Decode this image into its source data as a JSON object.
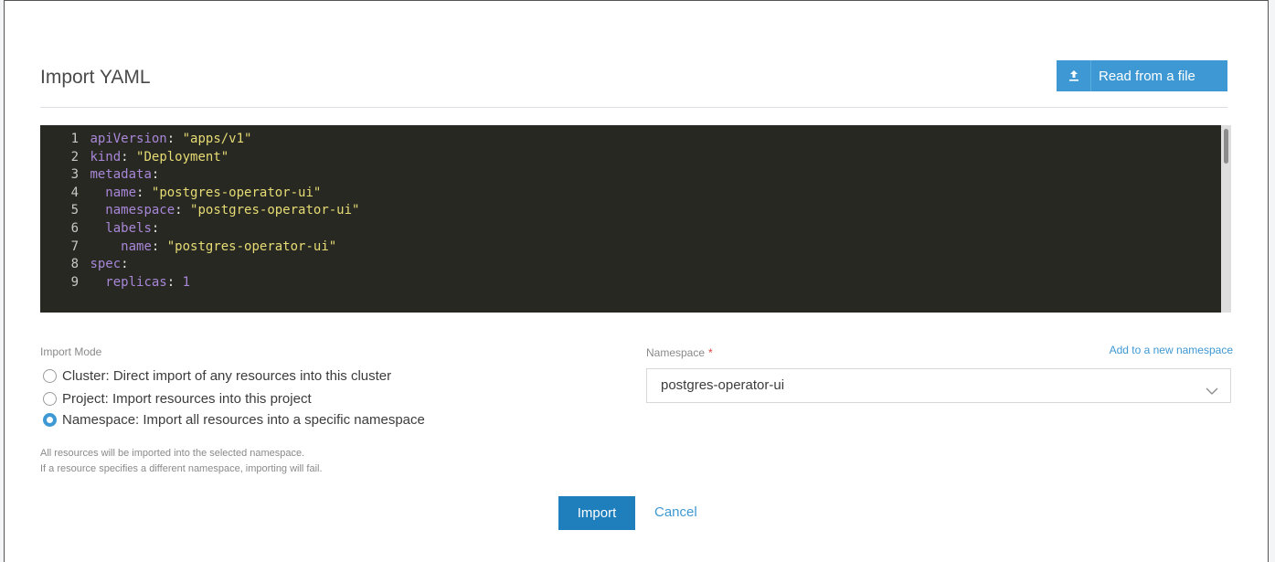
{
  "header": {
    "title": "Import YAML",
    "read_file_label": "Read from a file",
    "read_file_icon": "upload-icon"
  },
  "editor": {
    "lines": [
      {
        "n": "1",
        "indent": "",
        "key": "apiVersion",
        "value": "\"apps/v1\"",
        "vtype": "str"
      },
      {
        "n": "2",
        "indent": "",
        "key": "kind",
        "value": "\"Deployment\"",
        "vtype": "str"
      },
      {
        "n": "3",
        "indent": "",
        "key": "metadata",
        "value": "",
        "vtype": "str"
      },
      {
        "n": "4",
        "indent": "  ",
        "key": "name",
        "value": "\"postgres-operator-ui\"",
        "vtype": "str"
      },
      {
        "n": "5",
        "indent": "  ",
        "key": "namespace",
        "value": "\"postgres-operator-ui\"",
        "vtype": "str"
      },
      {
        "n": "6",
        "indent": "  ",
        "key": "labels",
        "value": "",
        "vtype": "str"
      },
      {
        "n": "7",
        "indent": "    ",
        "key": "name",
        "value": "\"postgres-operator-ui\"",
        "vtype": "str"
      },
      {
        "n": "8",
        "indent": "",
        "key": "spec",
        "value": "",
        "vtype": "str"
      },
      {
        "n": "9",
        "indent": "  ",
        "key": "replicas",
        "value": "1",
        "vtype": "num"
      }
    ]
  },
  "import_mode": {
    "label": "Import Mode",
    "options": [
      {
        "label": "Cluster: Direct import of any resources into this cluster",
        "checked": false
      },
      {
        "label": "Project: Import resources into this project",
        "checked": false
      },
      {
        "label": "Namespace: Import all resources into a specific namespace",
        "checked": true
      }
    ],
    "help_line1": "All resources will be imported into the selected namespace.",
    "help_line2": "If a resource specifies a different namespace, importing will fail."
  },
  "namespace": {
    "label": "Namespace",
    "required_mark": "*",
    "add_new_label": "Add to a new namespace",
    "selected": "postgres-operator-ui"
  },
  "footer": {
    "import_label": "Import",
    "cancel_label": "Cancel"
  },
  "colors": {
    "accent": "#3d98d3",
    "primary_button": "#1f7fbd",
    "editor_bg": "#272822",
    "string": "#e6db74",
    "key": "#a887d8"
  }
}
